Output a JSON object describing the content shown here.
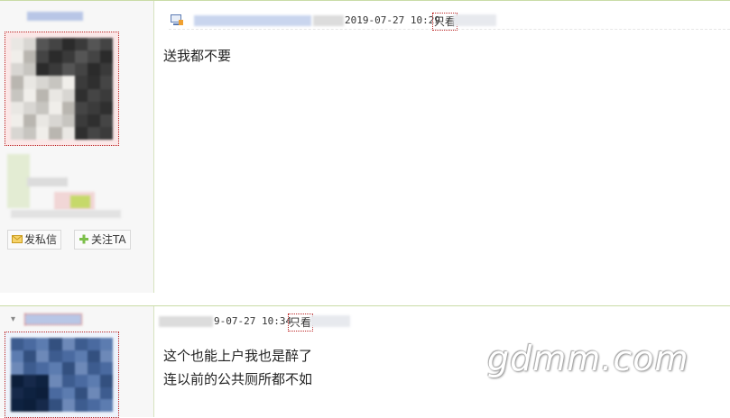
{
  "post1": {
    "timestamp": "2019-07-27 10:29",
    "only_view_label": "只看",
    "content": "送我都不要",
    "actions": {
      "message_label": "发私信",
      "follow_label": "关注TA"
    }
  },
  "post2": {
    "timestamp": "9-07-27 10:34",
    "only_view_label": "只看",
    "content_lines": [
      "这个也能上户我也是醉了",
      "连以前的公共厕所都不如"
    ]
  },
  "watermark": "gdmm.com",
  "icons": {
    "message": "envelope-icon",
    "follow": "plus-icon",
    "client": "computer-icon"
  }
}
